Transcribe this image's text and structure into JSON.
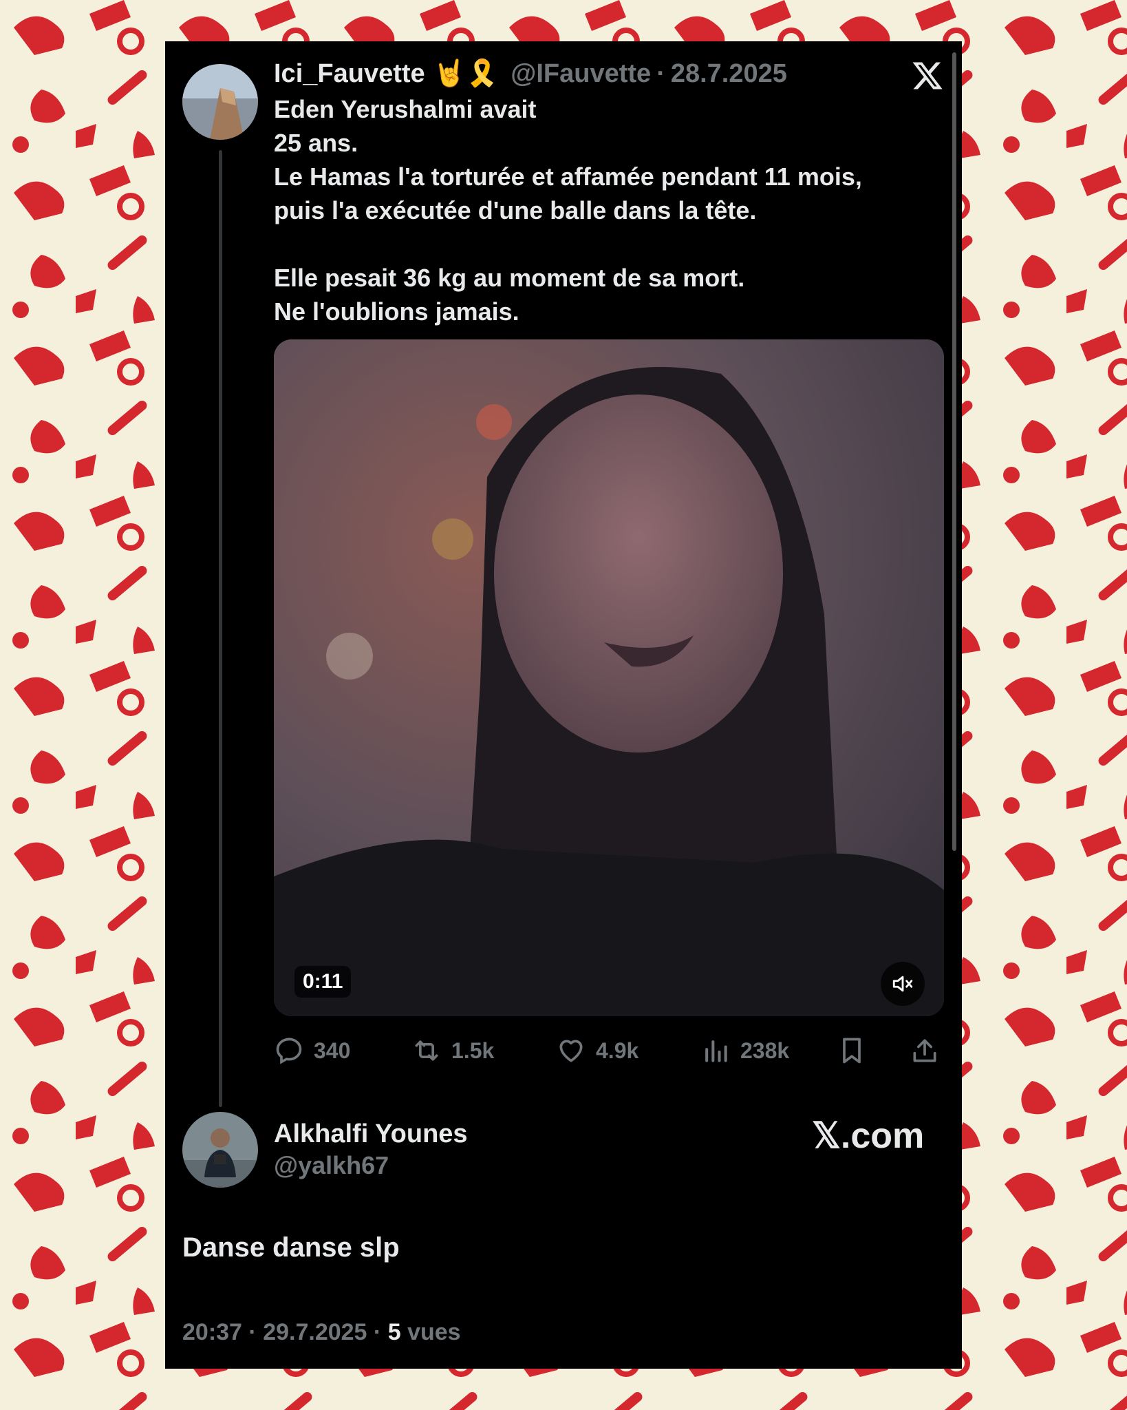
{
  "tweet": {
    "author_name": "Ici_Fauvette",
    "author_emojis": "🤘🎗️",
    "author_handle": "@IFauvette",
    "separator": "·",
    "date": "28.7.2025",
    "lines": [
      "Eden Yerushalmi avait",
      "25 ans.",
      "Le Hamas l'a torturée et affamée pendant 11 mois,",
      "puis l'a exécutée d'une balle dans la tête.",
      "",
      "Elle pesait 36 kg au moment de sa mort.",
      "Ne l'oublions jamais."
    ],
    "video_duration": "0:11",
    "stats": {
      "replies": "340",
      "reposts": "1.5k",
      "likes": "4.9k",
      "views": "238k"
    }
  },
  "reply": {
    "author_name": "Alkhalfi Younes",
    "author_handle": "@yalkh67",
    "text": "Danse danse slp",
    "time": "20:37",
    "separator": "·",
    "date": "29.7.2025",
    "views_count": "5",
    "views_label": "vues"
  },
  "branding": {
    "site": "𝕏.com"
  },
  "colors": {
    "pattern_red": "#d4272e",
    "pattern_bg": "#f5f0dc",
    "card_bg": "#000000",
    "muted_text": "#71767b"
  },
  "icons": [
    "x-logo-icon",
    "mute-icon",
    "reply-icon",
    "repost-icon",
    "like-icon",
    "views-icon",
    "bookmark-icon",
    "share-icon"
  ]
}
